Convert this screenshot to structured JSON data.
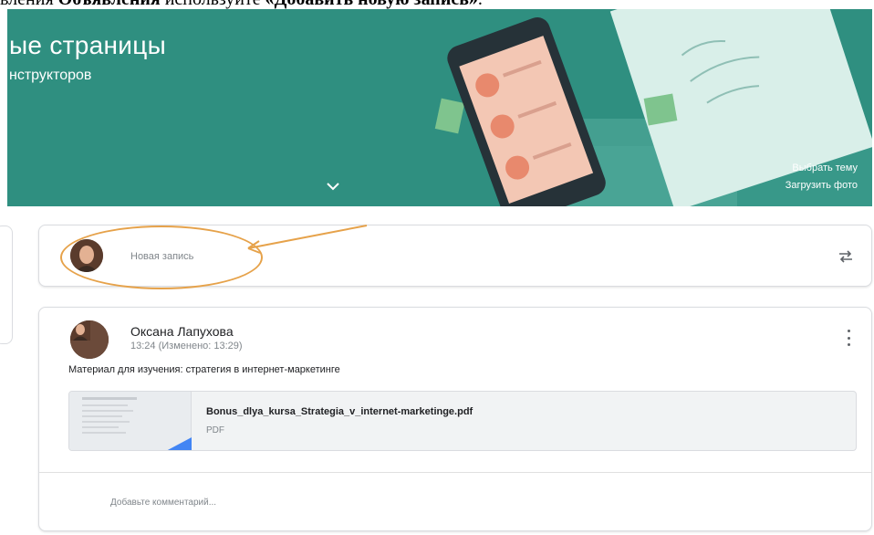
{
  "caption": {
    "prefix": "вления ",
    "section_name": "Объявления",
    "middle": " используйте ",
    "action_name": "«Добавить новую запись»",
    "suffix": "."
  },
  "banner": {
    "title": "ые страницы",
    "subtitle": "нструкторов",
    "select_theme_link": "Выбрать тему",
    "upload_photo_link": "Загрузить фото",
    "color": "#2f8f80"
  },
  "new_post": {
    "label": "Новая запись",
    "highlight_color": "#e6a24a"
  },
  "post": {
    "author": "Оксана Лапухова",
    "time": "13:24 (Изменено: 13:29)",
    "text": "Материал для изучения: стратегия в интернет-маркетинге",
    "attachment": {
      "file_name": "Bonus_dlya_kursa_Strategia_v_internet-marketinge.pdf",
      "file_type": "PDF"
    },
    "comment_placeholder": "Добавьте комментарий..."
  },
  "icons": {
    "chevron": "chevron-down-icon",
    "repost": "repost-icon",
    "more": "more-vert-icon"
  }
}
